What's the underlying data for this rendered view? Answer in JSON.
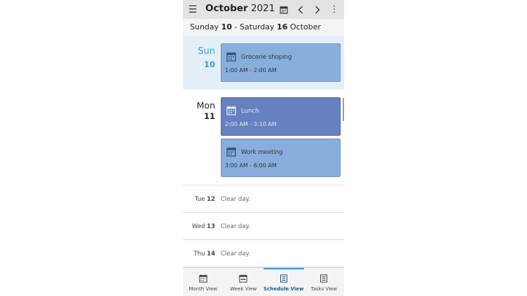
{
  "toolbar": {
    "menu_icon": "hamburger-icon",
    "title_month": "October",
    "title_year": "2021",
    "calendar_icon": "calendar-icon",
    "prev_icon": "chevron-left-icon",
    "next_icon": "chevron-right-icon",
    "more_icon": "more-vertical-icon"
  },
  "range": {
    "start_day": "Sunday",
    "start_num": "10",
    "separator": "-",
    "end_day": "Saturday",
    "end_num": "16",
    "end_month": "October"
  },
  "days": [
    {
      "name": "Sun",
      "num": "10",
      "events": [
        {
          "title": "Grocerie shoping",
          "time": "1:00 AM - 2:00 AM"
        }
      ]
    },
    {
      "name": "Mon",
      "num": "11",
      "events": [
        {
          "title": "Lunch",
          "time": "2:00 AM - 3:10 AM"
        },
        {
          "title": "Work meeting",
          "time": "3:00 AM - 6:00 AM"
        }
      ]
    }
  ],
  "clear_days": [
    {
      "name": "Tue",
      "num": "12",
      "text": "Clear day."
    },
    {
      "name": "Wed",
      "num": "13",
      "text": "Clear day."
    },
    {
      "name": "Thu",
      "num": "14",
      "text": "Clear day."
    }
  ],
  "nav": [
    {
      "label": "Month View",
      "icon": "month-calendar-icon"
    },
    {
      "label": "Week View",
      "icon": "week-calendar-icon"
    },
    {
      "label": "Schedule View",
      "icon": "schedule-list-icon",
      "active": true
    },
    {
      "label": "Tasks View",
      "icon": "tasks-list-icon"
    }
  ],
  "colors": {
    "accent": "#3a9bd6",
    "event_light": "#87aedd",
    "event_dark": "#6681bf",
    "today_bg": "#e3f0f8",
    "toolbar_bg": "#e3e3e3"
  }
}
